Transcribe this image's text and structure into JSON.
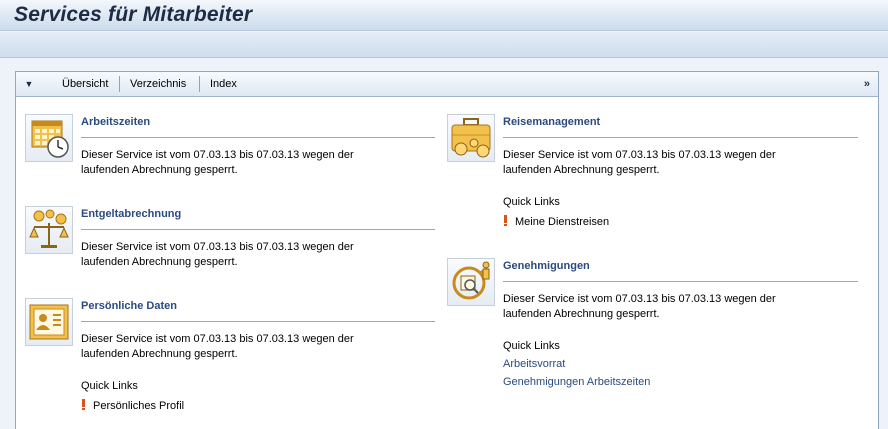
{
  "page": {
    "title": "Services für Mitarbeiter"
  },
  "toolbar": {
    "tabs": [
      "Übersicht",
      "Verzeichnis",
      "Index"
    ],
    "more_glyph": "»"
  },
  "services": {
    "arbeitszeiten": {
      "title": "Arbeitszeiten",
      "icon": "calendar-clock-icon",
      "text": "Dieser Service ist vom 07.03.13 bis 07.03.13 wegen der laufenden Abrechnung gesperrt."
    },
    "entgelt": {
      "title": "Entgeltabrechnung",
      "icon": "scales-coins-icon",
      "text": "Dieser Service ist vom 07.03.13 bis 07.03.13 wegen der laufenden Abrechnung gesperrt."
    },
    "persoenlich": {
      "title": "Persönliche Daten",
      "icon": "id-card-icon",
      "text": "Dieser Service ist vom 07.03.13 bis 07.03.13 wegen der laufenden Abrechnung gesperrt.",
      "quick_links_label": "Quick Links",
      "links": [
        "Persönliches Profil"
      ]
    },
    "reise": {
      "title": "Reisemanagement",
      "icon": "suitcase-coins-icon",
      "text": "Dieser Service ist vom 07.03.13 bis 07.03.13 wegen der laufenden Abrechnung gesperrt.",
      "quick_links_label": "Quick Links",
      "links": [
        "Meine Dienstreisen"
      ]
    },
    "genehmigungen": {
      "title": "Genehmigungen",
      "icon": "approval-cycle-icon",
      "text": "Dieser Service ist vom 07.03.13 bis 07.03.13 wegen der laufenden Abrechnung gesperrt.",
      "quick_links_label": "Quick Links",
      "links": [
        "Arbeitsvorrat",
        "Genehmigungen Arbeitszeiten"
      ]
    }
  },
  "colors": {
    "link": "#2b4a7e",
    "lock_marker": "#d9531e",
    "title_text": "#1f2a44"
  }
}
